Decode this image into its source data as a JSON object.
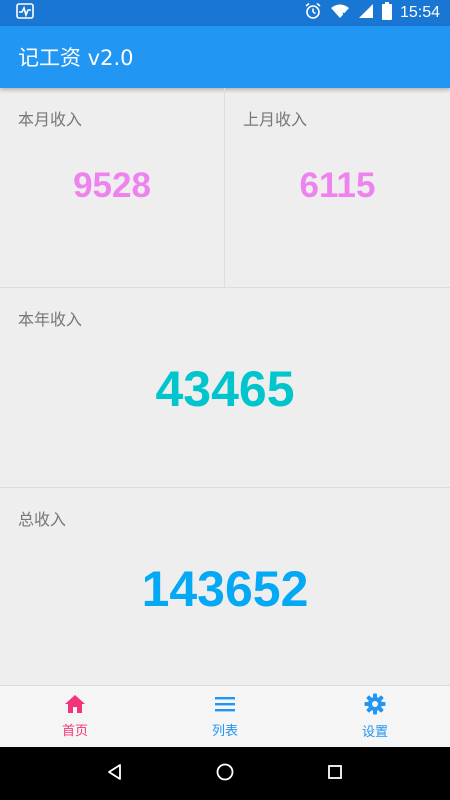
{
  "status_bar": {
    "time": "15:54",
    "icons": [
      "activity-monitor-icon",
      "alarm-icon",
      "wifi-icon",
      "signal-icon",
      "battery-icon"
    ]
  },
  "app_bar": {
    "title": "记工资 v2.0"
  },
  "stats": {
    "this_month": {
      "label": "本月收入",
      "value": "9528"
    },
    "last_month": {
      "label": "上月收入",
      "value": "6115"
    },
    "this_year": {
      "label": "本年收入",
      "value": "43465"
    },
    "total": {
      "label": "总收入",
      "value": "143652"
    }
  },
  "bottom_nav": {
    "items": [
      {
        "label": "首页",
        "icon": "home-icon",
        "active": true
      },
      {
        "label": "列表",
        "icon": "list-icon",
        "active": false
      },
      {
        "label": "设置",
        "icon": "gear-icon",
        "active": false
      }
    ]
  },
  "system_nav": {
    "icons": [
      "back-icon",
      "home-circle-icon",
      "recents-icon"
    ]
  },
  "colors": {
    "status_bar": "#1976D2",
    "app_bar": "#2196F3",
    "month_value": "#EE82EE",
    "year_value": "#00C5CD",
    "total_value": "#03A9F4",
    "nav_active": "#F2357A",
    "nav_inactive": "#2196F3"
  }
}
